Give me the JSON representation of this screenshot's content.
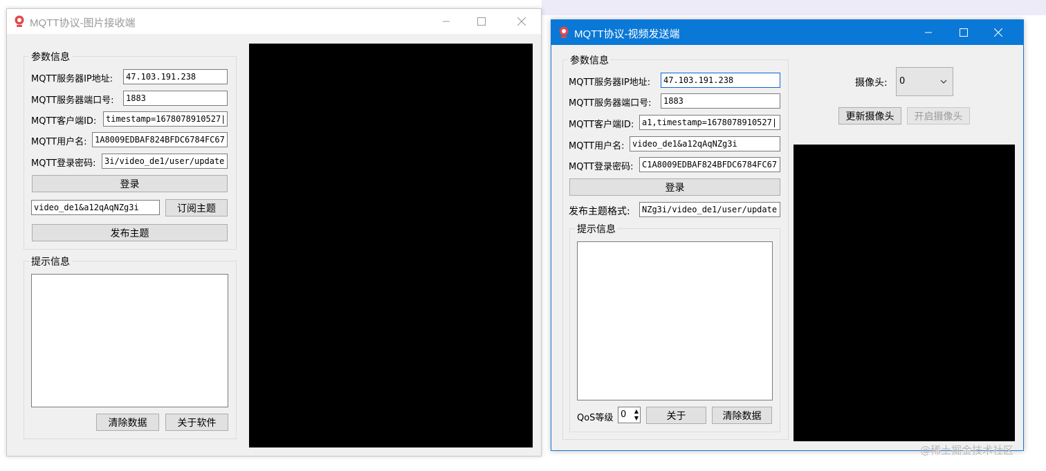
{
  "receiver": {
    "title": "MQTT协议-图片接收端",
    "params_group": "参数信息",
    "ip_label": "MQTT服务器IP地址:",
    "ip_value": "47.103.191.238",
    "port_label": "MQTT服务器端口号:",
    "port_value": "1883",
    "client_label": "MQTT客户端ID:",
    "client_value": "timestamp=1678078910527|",
    "user_label": "MQTT用户名:",
    "user_value": "1A8009EDBAF824BFDC6784FC67",
    "pwd_label": "MQTT登录密码:",
    "pwd_value": "3i/video_de1/user/update",
    "login_button": "登录",
    "subscribe_value": "video_de1&a12qAqNZg3i",
    "subscribe_button": "订阅主题",
    "publish_button": "发布主题",
    "info_group": "提示信息",
    "clear_button": "清除数据",
    "about_button": "关于软件"
  },
  "sender": {
    "title": "MQTT协议-视频发送端",
    "params_group": "参数信息",
    "ip_label": "MQTT服务器IP地址:",
    "ip_value": "47.103.191.238",
    "port_label": "MQTT服务器端口号:",
    "port_value": "1883",
    "client_label": "MQTT客户端ID:",
    "client_value": "a1,timestamp=1678078910527|",
    "user_label": "MQTT用户名:",
    "user_value": "video_de1&a12qAqNZg3i",
    "pwd_label": "MQTT登录密码:",
    "pwd_value": "C1A8009EDBAF824BFDC6784FC67",
    "login_button": "登录",
    "topic_label": "发布主题格式:",
    "topic_value": "NZg3i/video_de1/user/update",
    "info_group": "提示信息",
    "qos_label": "QoS等级",
    "qos_value": "0",
    "about_button": "关于",
    "clear_button": "清除数据",
    "camera_label": "摄像头:",
    "camera_value": "0",
    "refresh_camera_button": "更新摄像头",
    "open_camera_button": "开启摄像头"
  },
  "watermark": "@稀土掘金技术社区",
  "colors": {
    "title_active": "#0a78d7",
    "window_bg": "#f0f0f0",
    "video_bg": "#000000"
  }
}
